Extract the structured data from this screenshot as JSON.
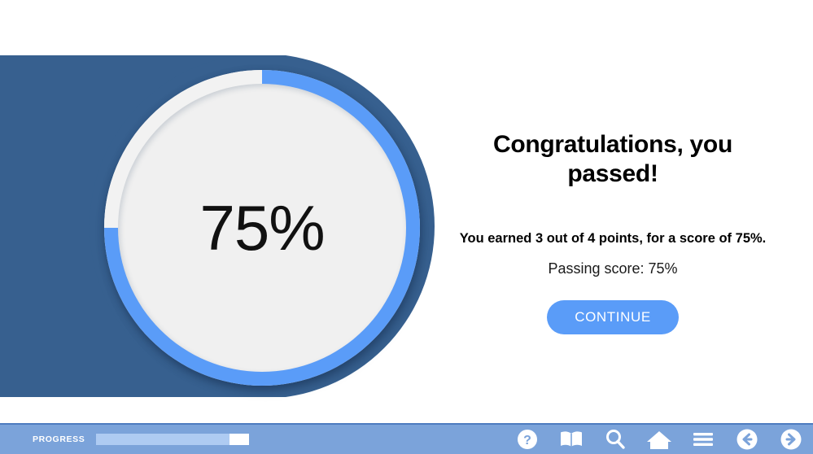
{
  "quiz_result": {
    "gauge": {
      "value_label": "75%",
      "percent": 75,
      "arc_color": "#5a9cf8",
      "remaining_color": "#f2f2f2",
      "face_color": "#f0f0f0",
      "backing_color": "#37608f"
    },
    "headline": "Congratulations, you passed!",
    "score_line": "You earned 3 out of 4 points, for a score of 75%.",
    "passing_line": "Passing score: 75%",
    "continue_label": "CONTINUE",
    "points_earned": 3,
    "points_total": 4,
    "score_percent": 75,
    "passing_percent": 75
  },
  "bottom_bar": {
    "progress_label": "PROGRESS",
    "progress_percent": 87,
    "bar_color": "#7ba3da",
    "fill_color": "#aecbf2",
    "icons": [
      {
        "name": "help-icon",
        "title": "Help"
      },
      {
        "name": "glossary-book-icon",
        "title": "Glossary"
      },
      {
        "name": "search-icon",
        "title": "Search"
      },
      {
        "name": "home-icon",
        "title": "Home"
      },
      {
        "name": "menu-icon",
        "title": "Menu"
      },
      {
        "name": "back-arrow-icon",
        "title": "Previous"
      },
      {
        "name": "forward-arrow-icon",
        "title": "Next"
      }
    ]
  }
}
